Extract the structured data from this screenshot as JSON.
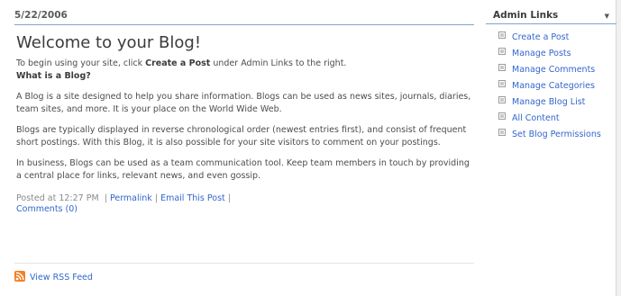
{
  "post": {
    "date": "5/22/2006",
    "title": "Welcome to your Blog!",
    "intro_prefix": "To begin using your site, click ",
    "intro_bold": "Create a Post",
    "intro_suffix": " under Admin Links to the right.",
    "subhead": "What is a Blog?",
    "paragraphs": [
      "A Blog is a site designed to help you share information. Blogs can be used as news sites, journals, diaries, team sites, and more. It is your place on the World Wide Web.",
      "Blogs are typically displayed in reverse chronological order (newest entries first), and consist of frequent short postings. With this Blog, it is also possible for your site visitors to comment on your postings.",
      "In business, Blogs can be used as a team communication tool. Keep team members in touch by providing a central place for links, relevant news, and even gossip."
    ],
    "posted_at": "Posted at 12:27 PM",
    "separator": "|",
    "permalink": "Permalink",
    "email": "Email This Post",
    "comments": "Comments (0)"
  },
  "rss": {
    "label": "View RSS Feed",
    "icon": "rss-feed-icon",
    "color": "#f57f20"
  },
  "sidebar": {
    "title": "Admin Links",
    "menu_icon": "dropdown-arrow-icon",
    "items": [
      {
        "label": "Create a Post"
      },
      {
        "label": "Manage Posts"
      },
      {
        "label": "Manage Comments"
      },
      {
        "label": "Manage Categories"
      },
      {
        "label": "Manage Blog List"
      },
      {
        "label": "All Content"
      },
      {
        "label": "Set Blog Permissions"
      }
    ]
  },
  "colors": {
    "link": "#3366cc",
    "rule": "#7fa5cc",
    "text": "#4c4c4c"
  }
}
